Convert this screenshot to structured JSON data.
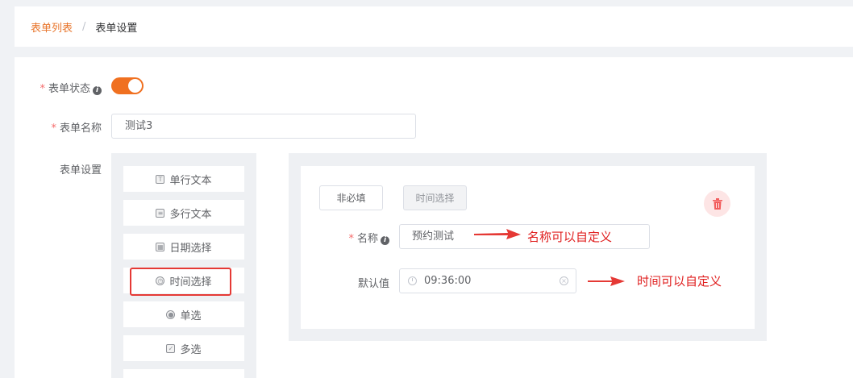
{
  "breadcrumb": {
    "link": "表单列表",
    "separator": "/",
    "current": "表单设置"
  },
  "form": {
    "status_label": "表单状态",
    "status_on": true,
    "name_label": "表单名称",
    "name_value": "测试3",
    "settings_label": "表单设置",
    "required_mark": "*"
  },
  "palette": {
    "items": [
      {
        "label": "单行文本",
        "icon": "text-line-icon"
      },
      {
        "label": "多行文本",
        "icon": "text-multiline-icon"
      },
      {
        "label": "日期选择",
        "icon": "calendar-icon"
      },
      {
        "label": "时间选择",
        "icon": "clock-icon"
      },
      {
        "label": "单选",
        "icon": "radio-icon"
      },
      {
        "label": "多选",
        "icon": "checkbox-icon"
      }
    ],
    "highlighted": "时间选择"
  },
  "field_card": {
    "required_button": "非必填",
    "type_button": "时间选择",
    "title_label": "名称",
    "title_value": "预约测试",
    "default_label": "默认值",
    "default_value": "09:36:00"
  },
  "annotations": {
    "name_note": "名称可以自定义",
    "time_note": "时间可以自定义",
    "color": "#e02020"
  },
  "colors": {
    "accent": "#f07020",
    "danger": "#e53935"
  }
}
